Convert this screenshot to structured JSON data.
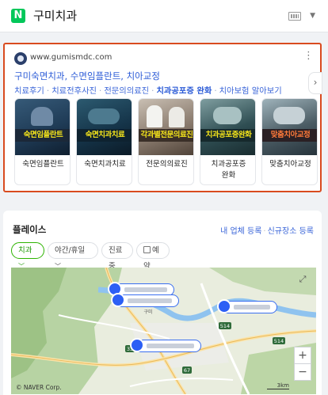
{
  "header": {
    "logo": "N",
    "query": "구미치과"
  },
  "ad": {
    "site": "www.gumismdc.com",
    "title": "구미숙면치과, 수면임플란트, 치아교정",
    "links": [
      "치료후기",
      "치료전후사진",
      "전문의의료진",
      "치과공포증 완화",
      "치아보험 알아보기"
    ],
    "cards": [
      {
        "band": "숙면임플란트",
        "label": "숙면임플란트",
        "band_color": "#f5e51b",
        "bg": "#1f3b56"
      },
      {
        "band": "숙면치과치료",
        "label": "숙면치과치료",
        "band_color": "#f5e51b",
        "bg": "#153449"
      },
      {
        "band": "각과별전문의료진",
        "label": "전문의의료진",
        "band_color": "#f5e51b",
        "bg": "#5b5047"
      },
      {
        "band": "치과공포증완화",
        "label": "치과공포증\n완화",
        "band_color": "#f5e51b",
        "bg": "#2f4e53"
      },
      {
        "band": "맞춤치아교정",
        "label": "맞춤치아교정",
        "band_color": "#ff7a3a",
        "bg": "#4a5b63"
      }
    ]
  },
  "place": {
    "title": "플레이스",
    "links": [
      "내 업체 등록",
      "신규장소 등록"
    ],
    "filters": [
      "치과",
      "야간/휴일",
      "진료중",
      "예약"
    ],
    "map_credit": "© NAVER Corp.",
    "scale": "3km",
    "road_labels": [
      "514",
      "514",
      "33",
      "67",
      "구미"
    ]
  },
  "colors": {
    "brand": "#03c75a",
    "ad_border": "#d94b1f",
    "link": "#3b66d9",
    "pin": "#2c5ff5"
  }
}
